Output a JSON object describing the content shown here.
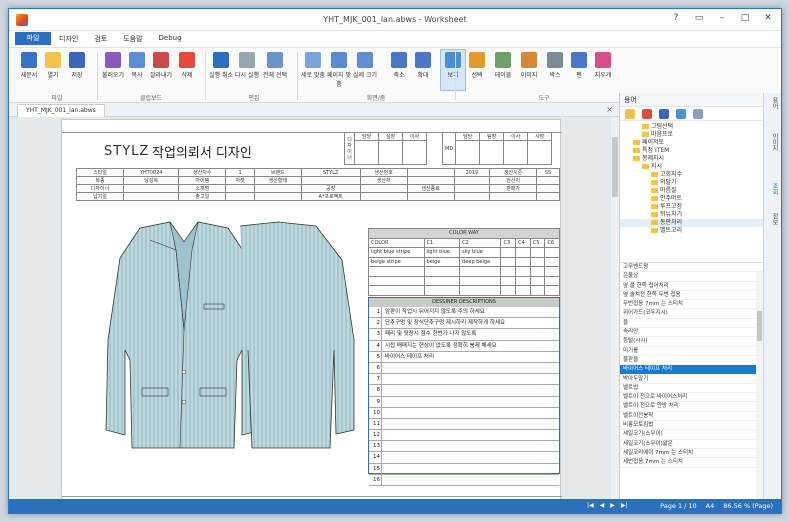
{
  "window": {
    "title": "YHT_MJK_001_lan.abws - Worksheet",
    "controls": [
      "?",
      "▭",
      "–",
      "□",
      "✕"
    ]
  },
  "menu": {
    "file_label": "파일",
    "items": [
      "디자인",
      "검토",
      "도움말",
      "Debug"
    ]
  },
  "ribbon": {
    "buttons": [
      "새문서",
      "열기",
      "저장",
      "불러오기",
      "복사",
      "잘라내기",
      "삭제",
      "실행 취소",
      "다시 실행",
      "전체 선택",
      "세로 맞춤",
      "페이지 맞춤",
      "실제 크기",
      "축소",
      "확대",
      "보기",
      "선택",
      "테이블",
      "이미지",
      "박스",
      "펜",
      "지우개"
    ],
    "groups": [
      "파일",
      "클립보드",
      "편집",
      "화면/줌",
      "도구"
    ]
  },
  "doc_tab": "YHT_MJK_001_lan.abws",
  "sheet": {
    "brand": "STYLZ",
    "title": "작업의뢰서 디자인",
    "approval1": {
      "label": "디자이너",
      "cols": [
        "담당",
        "실장",
        "이사"
      ]
    },
    "approval2": {
      "label": "MD",
      "cols": [
        "담당",
        "팀장",
        "이사",
        "사장"
      ]
    },
    "info_rows": [
      [
        "스타일",
        "YHT0024",
        "생산차수",
        "1",
        "브랜드",
        "STYLZ",
        "생산번호",
        "",
        "2019",
        "생산시즌",
        "SS"
      ],
      [
        "복종",
        "남성복",
        "아이템",
        "자켓",
        "생산형태",
        "",
        "생산처",
        "",
        "",
        "원산지",
        ""
      ],
      [
        "디자이너",
        "",
        "소재명",
        "",
        "",
        "공장",
        "",
        "생산종료",
        "",
        "판매가",
        ""
      ],
      [
        "납기일",
        "",
        "출고일",
        "",
        "",
        "A*프로젝트",
        "",
        "",
        "",
        "",
        ""
      ]
    ],
    "color_way": {
      "title": "COLOR WAY",
      "headers": [
        "COLOR",
        "C1",
        "C2",
        "C3",
        "C4",
        "C5",
        "C6"
      ],
      "rows": [
        [
          "light blue stripe",
          "light blue",
          "sky blue",
          "",
          "",
          "",
          ""
        ],
        [
          "beige stripe",
          "beige",
          "deep beige",
          "",
          "",
          "",
          ""
        ]
      ]
    },
    "designer": {
      "title": "DESSINER DESCRIPTIONS",
      "rows": [
        "앞판이 작업시 뒤어지지 않도록 주의 하세요",
        "단추구멍 및 장식단추구멍 제시하리 제작하게 하세요",
        "패리 및 뒷장시 점수 한번가 나지 않도록",
        "시접 매매지는 현상이 없도록 정확히 봉제 해세요",
        "바이어스 테이프 처리",
        "",
        "",
        "",
        "",
        "",
        "",
        "",
        "",
        "",
        "",
        ""
      ]
    }
  },
  "panel": {
    "title": "용어",
    "tree": [
      {
        "d": 2,
        "t": "그림선택"
      },
      {
        "d": 2,
        "t": "마음프로"
      },
      {
        "d": 1,
        "t": "페이저토"
      },
      {
        "d": 1,
        "t": "특정 ITEM"
      },
      {
        "d": 1,
        "t": "봉제지시"
      },
      {
        "d": 2,
        "t": "지시"
      },
      {
        "d": 3,
        "t": "고회지수"
      },
      {
        "d": 3,
        "t": "의달기"
      },
      {
        "d": 3,
        "t": "마름질"
      },
      {
        "d": 3,
        "t": "안주머트"
      },
      {
        "d": 3,
        "t": "루프고정"
      },
      {
        "d": 3,
        "t": "뒤뉴지기"
      },
      {
        "d": 3,
        "t": "동판처리"
      },
      {
        "d": 3,
        "t": "벨트고리"
      }
    ],
    "tree_selected": 12,
    "list": [
      "고무밴드왕",
      "은불상",
      "옆 을 한쪽 접어처리",
      "옆 솔쳐전 한쪽 두번 접음",
      "두번접음 7mm 는 스티치",
      "위어가드(코두지시)",
      "을",
      "속리안",
      "등털(시시)",
      "미기를",
      "물판을",
      "바이어스 테이프 처리",
      "박아두말기",
      "벨트법",
      "벨트이 전으로 바이어스처리",
      "벨트이 전으로 얀방 처리",
      "벨트이전봉착",
      "비롱모토킴법",
      "세일코기(스무이)",
      "세일코기(스무이)얇은",
      "세일코리에이 7mm 는 스티치",
      "세번접음 7mm 는 스티치"
    ],
    "list_selected": 11
  },
  "right_tabs": [
    "용어",
    "이미지",
    "조회",
    "정보"
  ],
  "status": {
    "page": "Page 1 / 10",
    "size": "A4",
    "zoom": "86.56 % (Page)"
  }
}
